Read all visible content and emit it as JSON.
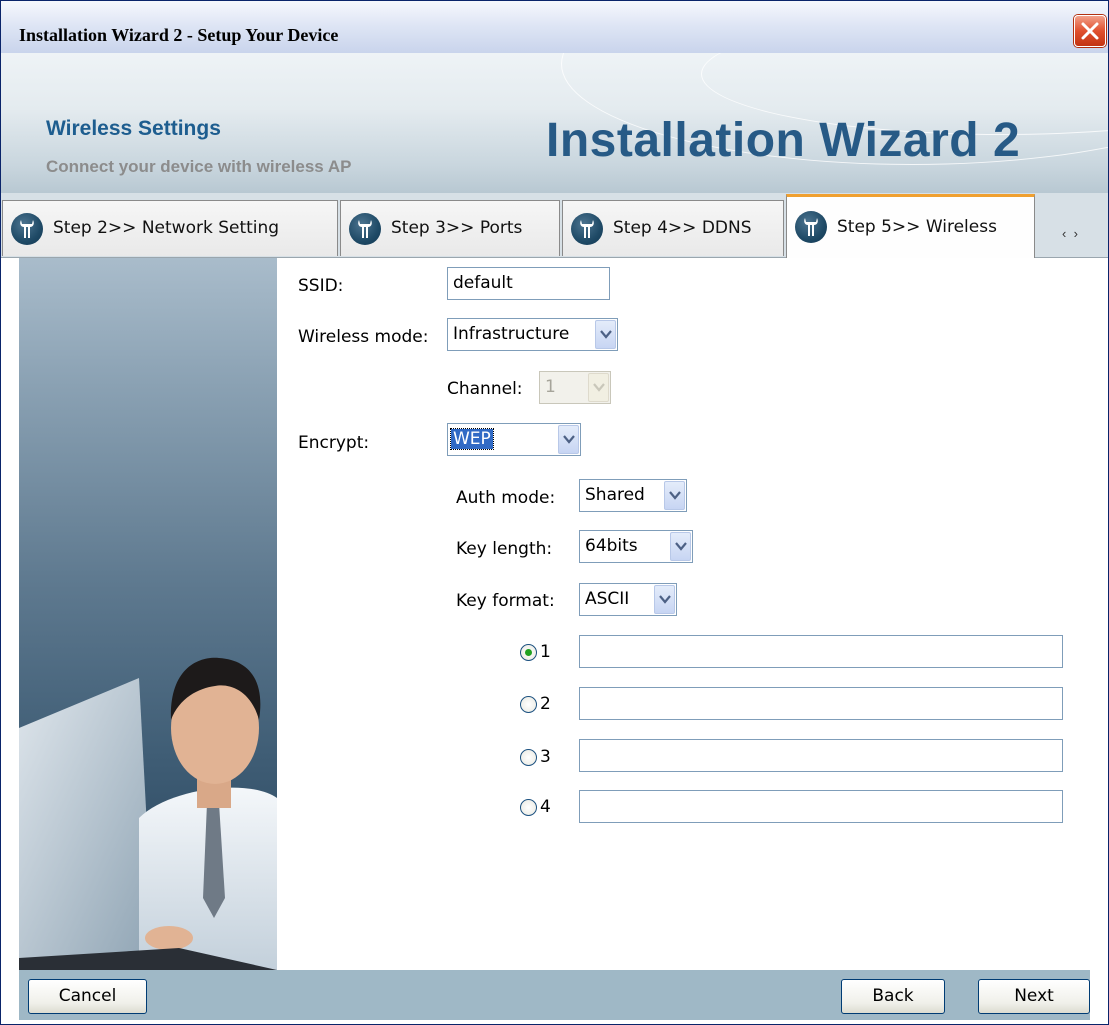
{
  "window": {
    "title": "Installation Wizard 2 - Setup Your Device"
  },
  "banner": {
    "heading": "Wireless Settings",
    "subheading": "Connect your device with wireless AP",
    "product_title": "Installation Wizard 2"
  },
  "tabs": [
    {
      "label": "Step 2>> Network Setting",
      "active": false
    },
    {
      "label": "Step 3>> Ports",
      "active": false
    },
    {
      "label": "Step 4>> DDNS",
      "active": false
    },
    {
      "label": "Step 5>> Wireless",
      "active": true
    }
  ],
  "tab_scroll": {
    "left": "‹",
    "right": "›"
  },
  "form": {
    "ssid_label": "SSID:",
    "ssid_value": "default",
    "wireless_mode_label": "Wireless mode:",
    "wireless_mode_value": "Infrastructure",
    "channel_label": "Channel:",
    "channel_value": "1",
    "encrypt_label": "Encrypt:",
    "encrypt_value": "WEP",
    "auth_mode_label": "Auth mode:",
    "auth_mode_value": "Shared",
    "key_length_label": "Key length:",
    "key_length_value": "64bits",
    "key_format_label": "Key format:",
    "key_format_value": "ASCII",
    "keys": [
      {
        "number": "1",
        "selected": true,
        "value": ""
      },
      {
        "number": "2",
        "selected": false,
        "value": ""
      },
      {
        "number": "3",
        "selected": false,
        "value": ""
      },
      {
        "number": "4",
        "selected": false,
        "value": ""
      }
    ]
  },
  "buttons": {
    "cancel": "Cancel",
    "back": "Back",
    "next": "Next"
  },
  "colors": {
    "accent_tab_border": "#f0a030",
    "heading_blue": "#1d5d8f",
    "selection_blue": "#316ac5",
    "radio_dot": "#21a121",
    "button_bar": "#9fb8c6"
  }
}
